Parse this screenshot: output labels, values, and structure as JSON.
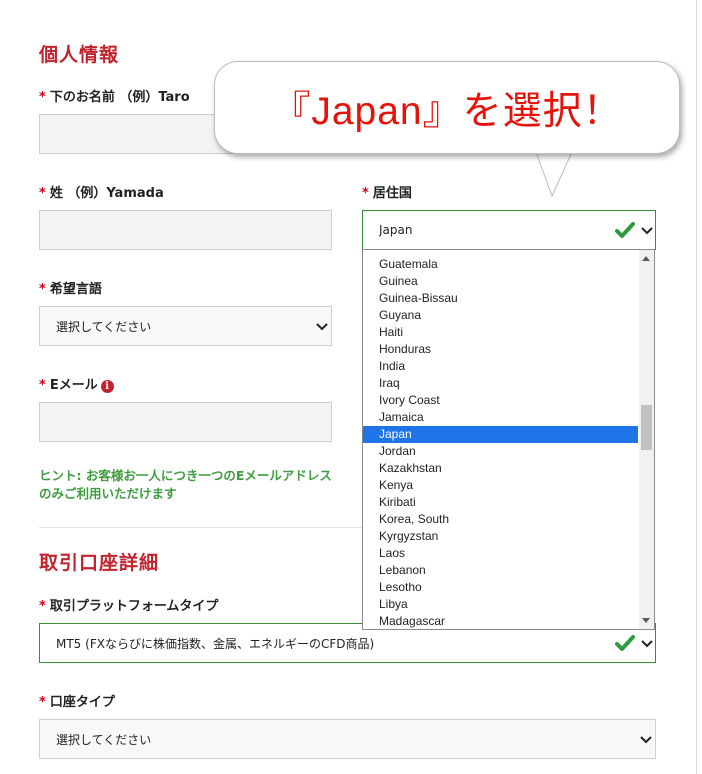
{
  "personal": {
    "title": "個人情報",
    "first_name_label": "下のお名前 （例）Taro",
    "last_name_label": "姓 （例）Yamada",
    "country_label": "居住国",
    "country_value": "Japan",
    "language_label": "希望言語",
    "language_value": "選択してください",
    "email_label": "Eメール",
    "email_info_icon": "i",
    "hint": "ヒント: お客様お一人につき一つのEメールアドレスのみご利用いただけます"
  },
  "account": {
    "title": "取引口座詳細",
    "platform_label": "取引プラットフォームタイプ",
    "platform_value": "MT5 (FXならびに株価指数、金属、エネルギーのCFD商品)",
    "account_type_label": "口座タイプ",
    "account_type_value": "選択してください"
  },
  "required_mark": "*",
  "country_dropdown": {
    "options": [
      "Guatemala",
      "Guinea",
      "Guinea-Bissau",
      "Guyana",
      "Haiti",
      "Honduras",
      "India",
      "Iraq",
      "Ivory Coast",
      "Jamaica",
      "Japan",
      "Jordan",
      "Kazakhstan",
      "Kenya",
      "Kiribati",
      "Korea, South",
      "Kyrgyzstan",
      "Laos",
      "Lebanon",
      "Lesotho",
      "Libya",
      "Madagascar"
    ],
    "selected": "Japan"
  },
  "callout": {
    "text": "『Japan』を選択！"
  },
  "colors": {
    "section_title": "#c3232e",
    "hint": "#3f9d3f",
    "valid_border": "#3c8a3c",
    "check": "#2e9a3e",
    "selection": "#1f74e8",
    "callout_text": "#e4140c"
  }
}
